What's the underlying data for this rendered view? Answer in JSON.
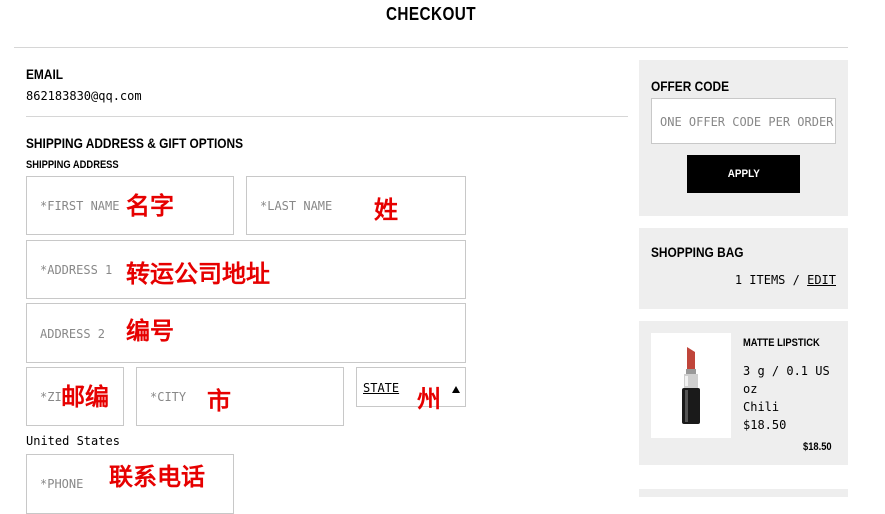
{
  "page": {
    "title": "CHECKOUT"
  },
  "email": {
    "label": "EMAIL",
    "value": "862183830@qq.com"
  },
  "shipping": {
    "section_title": "SHIPPING ADDRESS & GIFT OPTIONS",
    "subtitle": "SHIPPING ADDRESS",
    "first_name": {
      "placeholder": "*FIRST NAME",
      "annotation": "名字"
    },
    "last_name": {
      "placeholder": "*LAST NAME",
      "annotation": "姓"
    },
    "address1": {
      "placeholder": "*ADDRESS 1",
      "annotation": "转运公司地址"
    },
    "address2": {
      "placeholder": "ADDRESS 2",
      "annotation": "编号"
    },
    "zip": {
      "placeholder": "*ZI",
      "annotation": "邮编"
    },
    "city": {
      "placeholder": "*CITY",
      "annotation": "市"
    },
    "state": {
      "label": "STATE",
      "annotation": "州"
    },
    "country": "United States",
    "phone": {
      "placeholder": "*PHONE",
      "annotation": "联系电话"
    }
  },
  "offer": {
    "title": "OFFER CODE",
    "placeholder": "ONE OFFER CODE PER ORDER",
    "apply_label": "APPLY"
  },
  "bag": {
    "title": "SHOPPING BAG",
    "items_text": "1 ITEMS /",
    "edit_label": "EDIT"
  },
  "product": {
    "name": "MATTE LIPSTICK",
    "size_line1": "3 g / 0.1 US",
    "size_line2": "oz",
    "shade": "Chili",
    "unit_price": "$18.50",
    "total": "$18.50",
    "image_icon": "lipstick-image",
    "colors": {
      "bullet": "#c0453a",
      "tube": "#1a1a1a"
    }
  }
}
